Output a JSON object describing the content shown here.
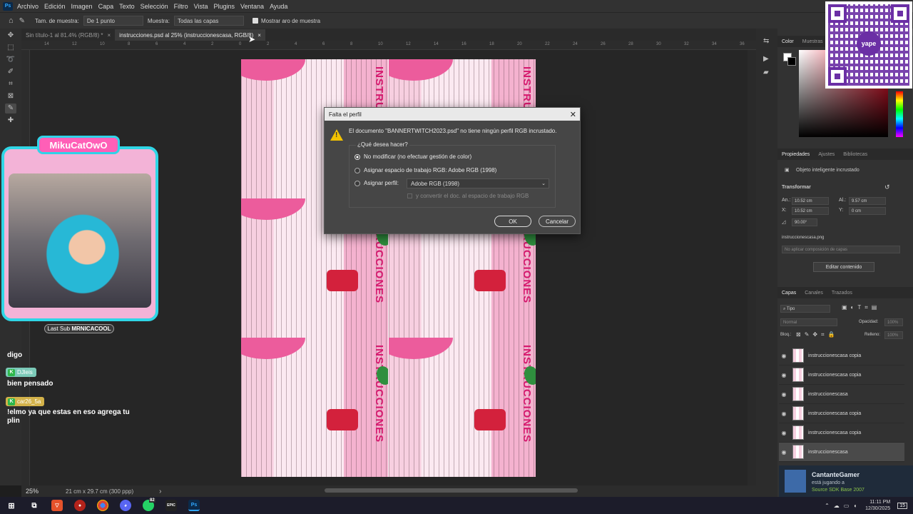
{
  "menubar": {
    "logo": "Ps",
    "items": [
      "Archivo",
      "Edición",
      "Imagen",
      "Capa",
      "Texto",
      "Selección",
      "Filtro",
      "Vista",
      "Plugins",
      "Ventana",
      "Ayuda"
    ]
  },
  "options": {
    "sample_size_label": "Tam. de muestra:",
    "sample_size_value": "De 1 punto",
    "sample_label": "Muestra:",
    "sample_value": "Todas las capas",
    "ring_label": "Mostrar aro de muestra"
  },
  "tabs": [
    {
      "label": "Sin título-1 al 81.4% (RGB/8) *",
      "close": "×"
    },
    {
      "label": "instrucciones.psd al 25% (instruccionescasa, RGB/8)",
      "close": "×"
    }
  ],
  "ruler_ticks": [
    "14",
    "12",
    "10",
    "8",
    "6",
    "4",
    "2",
    "0",
    "2",
    "4",
    "6",
    "8",
    "10",
    "12",
    "14",
    "16",
    "18",
    "20",
    "22",
    "24",
    "26",
    "28",
    "30",
    "32",
    "34",
    "36"
  ],
  "document": {
    "tile_title": "INSTRUCCIONES"
  },
  "status": {
    "zoom": "25%",
    "doc_size": "21 cm x 29.7 cm (300 ppp)",
    "arrow": "›"
  },
  "dialog": {
    "title": "Falta el perfil",
    "close": "✕",
    "message": "El documento \"BANNERTWITCH2023.psd\" no tiene ningún perfil RGB incrustado.",
    "question": "¿Qué desea hacer?",
    "option1": "No modificar (no efectuar gestión de color)",
    "option2": "Asignar espacio de trabajo RGB: Adobe RGB (1998)",
    "option3": "Asignar perfil:",
    "profile_value": "Adobe RGB (1998)",
    "convert_label": "y convertir el doc. al espacio de trabajo RGB",
    "ok": "OK",
    "cancel": "Cancelar"
  },
  "panels": {
    "color_tabs": [
      "Color",
      "Muestras"
    ],
    "props_tabs": [
      "Propiedades",
      "Ajustes",
      "Bibliotecas"
    ],
    "object_type": "Objeto inteligente incrustado",
    "transform_label": "Transformar",
    "an_label": "An.:",
    "an_value": "10.52 cm",
    "al_label": "Al.:",
    "al_value": "9.57 cm",
    "x_label": "X:",
    "x_value": "10.52 cm",
    "y_label": "Y:",
    "y_value": "0 cm",
    "angle_value": "90.00°",
    "file_name": "instruccionescasa.png",
    "comp_placeholder": "No aplicar composición de capas",
    "edit_button": "Editar contenido",
    "layers_tabs": [
      "Capas",
      "Canales",
      "Trazados"
    ],
    "type_search": "Tipo",
    "blend_mode": "Normal",
    "opacity_label": "Opacidad:",
    "opacity_value": "100%",
    "lock_label": "Bloq.:",
    "fill_label": "Relleno:",
    "fill_value": "100%",
    "layers": [
      {
        "name": "instruccionescasa copia"
      },
      {
        "name": "instruccionescasa copia"
      },
      {
        "name": "instruccionescasa"
      },
      {
        "name": "instruccionescasa copia"
      },
      {
        "name": "instruccionescasa copia"
      },
      {
        "name": "instruccionescasa"
      }
    ]
  },
  "stream": {
    "cam_name": "MikuCatOwO",
    "last_sub_label": "Last Sub",
    "last_sub_name": "MRNICACOOL",
    "chat": [
      {
        "user": "",
        "text": "digo"
      },
      {
        "user": "DJleis",
        "text": "bien pensado"
      },
      {
        "user": "car26_5a",
        "text": "!elmo ya que estas en eso agrega tu plin"
      }
    ],
    "qr_logo": "yape"
  },
  "notification": {
    "user": "CantanteGamer",
    "status": "está jugando a",
    "game": "Source SDK Base 2007"
  },
  "taskbar": {
    "time": "11:11 PM",
    "date": "12/30/2025",
    "badge": "82",
    "notif_count": "15",
    "epic_label": "EPIC"
  },
  "colors": {
    "accent_blue": "#31a8ff",
    "warning": "#f2c200",
    "pink": "#d61a6f",
    "cam_border": "#2fd6e6"
  }
}
